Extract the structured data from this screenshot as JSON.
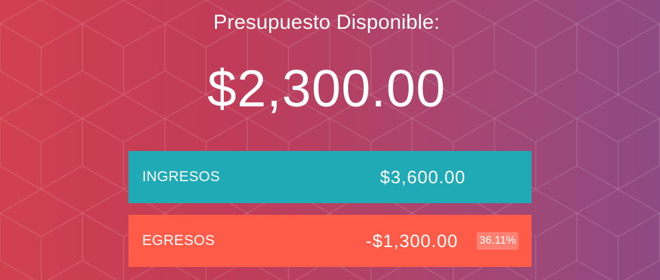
{
  "budget": {
    "title": "Presupuesto Disponible:",
    "total": "$2,300.00"
  },
  "income": {
    "label": "INGRESOS",
    "amount": "$3,600.00"
  },
  "expenses": {
    "label": "EGRESOS",
    "amount": "-$1,300.00",
    "percentage": "36.11%",
    "percentage_value": 36.11
  },
  "colors": {
    "income_bg": "#1faab5",
    "expense_bg": "#ff5b49",
    "gradient_start": "#d1404f",
    "gradient_end": "#8e4a82"
  }
}
